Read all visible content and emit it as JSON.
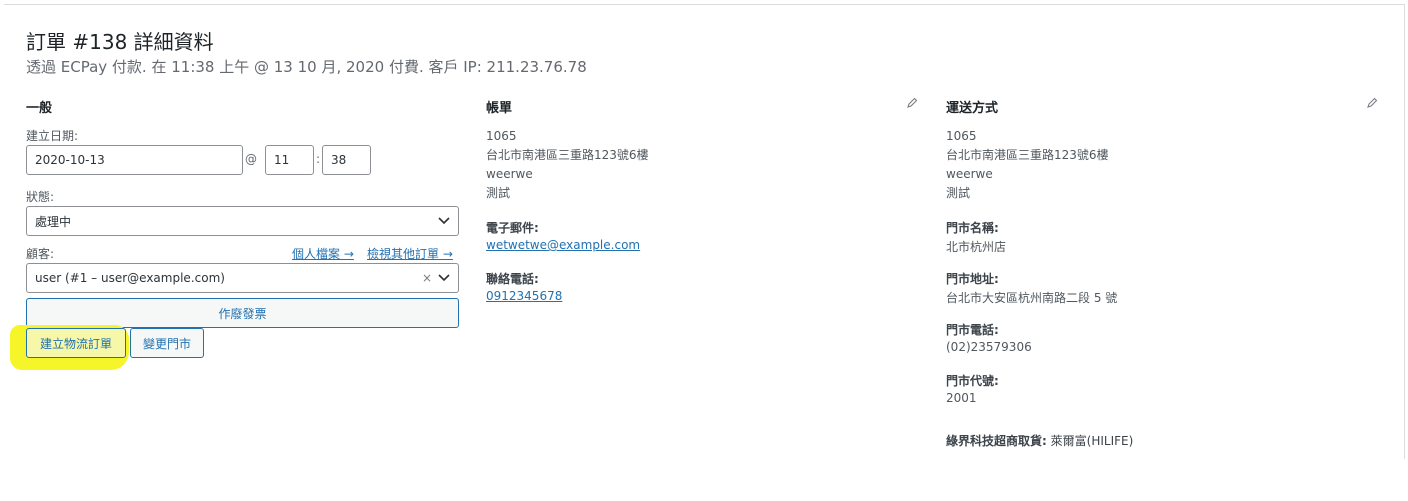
{
  "header": {
    "title": "訂單 #138 詳細資料",
    "subtitle": "透過 ECPay 付款. 在 11:38 上午 @ 13 10 月, 2020 付費. 客戶 IP: 211.23.76.78"
  },
  "general": {
    "heading": "一般",
    "date_label": "建立日期:",
    "date_value": "2020-10-13",
    "at": "@",
    "hour": "11",
    "colon": ":",
    "minute": "38",
    "status_label": "狀態:",
    "status_value": "處理中",
    "customer_label": "顧客:",
    "profile_link": "個人檔案 →",
    "other_orders_link": "檢視其他訂單 →",
    "customer_value": "user (#1 – user@example.com)",
    "clear_symbol": "×",
    "void_invoice_button": "作廢發票",
    "create_logistics_button": "建立物流訂單",
    "change_store_button": "變更門市"
  },
  "billing": {
    "heading": "帳單",
    "address_lines": [
      "1065",
      "台北市南港區三重路123號6樓",
      "weerwe",
      "測試"
    ],
    "email_label": "電子郵件:",
    "email_value": "wetwetwe@example.com",
    "phone_label": "聯絡電話:",
    "phone_value": "0912345678"
  },
  "shipping": {
    "heading": "運送方式",
    "address_lines": [
      "1065",
      "台北市南港區三重路123號6樓",
      "weerwe",
      "測試"
    ],
    "store_name_label": "門市名稱:",
    "store_name_value": "北市杭州店",
    "store_address_label": "門市地址:",
    "store_address_value": "台北市大安區杭州南路二段 5 號",
    "store_phone_label": "門市電話:",
    "store_phone_value": "(02)23579306",
    "store_code_label": "門市代號:",
    "store_code_value": "2001",
    "method_label": "綠界科技超商取貨:",
    "method_value": "萊爾富(HILIFE)"
  },
  "icons": {
    "pencil": "pencil-icon",
    "chevron": "chevron-down-icon"
  },
  "colors": {
    "link": "#2271b1",
    "highlight": "#f5f52a"
  }
}
